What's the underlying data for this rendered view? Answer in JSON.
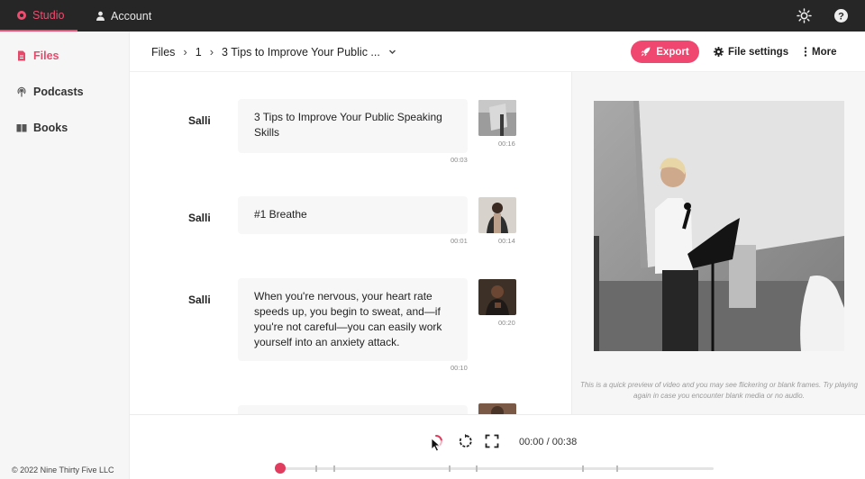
{
  "topbar": {
    "tabs": [
      {
        "label": "Studio",
        "icon": "gear-icon",
        "active": true
      },
      {
        "label": "Account",
        "icon": "user-icon",
        "active": false
      }
    ],
    "icons": [
      "sun-icon",
      "help-icon"
    ],
    "accent_color": "#ee4d6f"
  },
  "sidebar": {
    "items": [
      {
        "label": "Files",
        "icon": "file-icon",
        "active": true
      },
      {
        "label": "Podcasts",
        "icon": "podcast-icon",
        "active": false
      },
      {
        "label": "Books",
        "icon": "book-icon",
        "active": false
      }
    ],
    "copyright": "© 2022 Nine Thirty Five LLC"
  },
  "header": {
    "breadcrumb": [
      "Files",
      "1",
      "3 Tips to Improve Your Public ..."
    ],
    "export_label": "Export",
    "file_settings_label": "File settings",
    "more_label": "More"
  },
  "transcript": {
    "rows": [
      {
        "speaker": "Salli",
        "text": "3 Tips to Improve Your Public Speaking Skills",
        "time": "00:03",
        "thumb_time": "00:16"
      },
      {
        "speaker": "Salli",
        "text": "#1 Breathe",
        "time": "00:01",
        "thumb_time": "00:14"
      },
      {
        "speaker": "Salli",
        "text": "When you're nervous, your heart rate speeds up, you begin to sweat, and—if you're not careful—you can easily work yourself into an anxiety attack.",
        "time": "00:10",
        "thumb_time": "00:20"
      }
    ]
  },
  "preview": {
    "note": "This is a quick preview of video and you may see flickering or blank frames. Try playing again in case you encounter blank media or no audio."
  },
  "player": {
    "time": "00:00 / 00:38",
    "progress": 0.0,
    "controls": [
      "loading-icon",
      "replay-icon",
      "fullscreen-icon"
    ]
  }
}
